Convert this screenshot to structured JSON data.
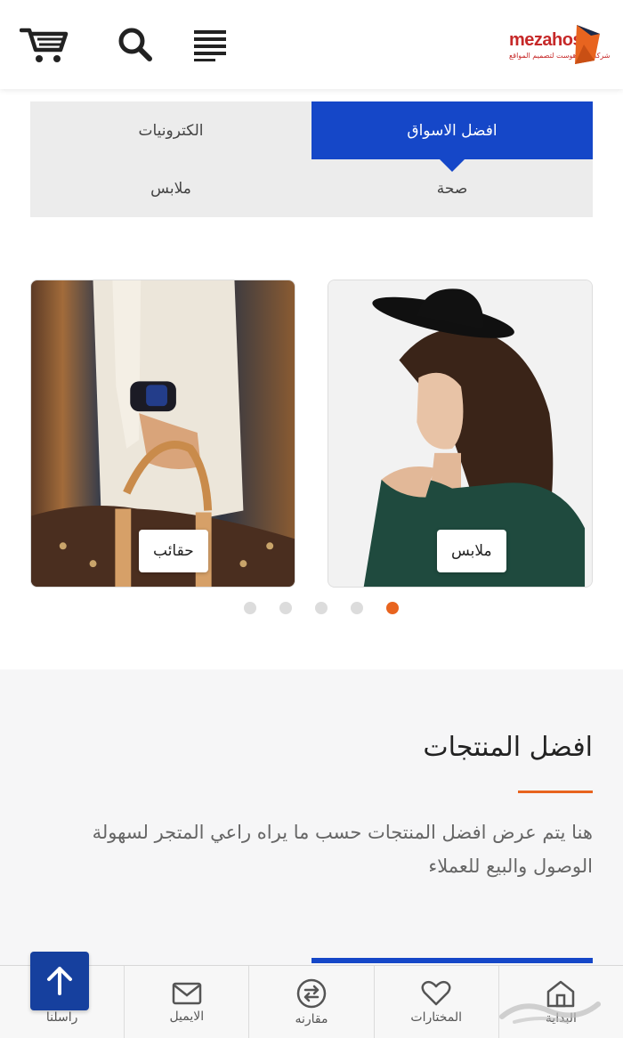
{
  "header": {
    "logo_text": "mezahost",
    "logo_subtitle": "شركة ميزا هوست لتصميم المواقع",
    "icons": [
      "cart-icon",
      "search-icon",
      "menu-icon"
    ]
  },
  "tabs": [
    {
      "label": "افضل الاسواق",
      "active": true
    },
    {
      "label": "الكترونيات",
      "active": false
    },
    {
      "label": "صحة",
      "active": false
    },
    {
      "label": "ملابس",
      "active": false
    }
  ],
  "carousel": {
    "cards": [
      {
        "label": "ملابس"
      },
      {
        "label": "حقائب"
      }
    ],
    "dot_count": 5,
    "active_dot": 5
  },
  "featured": {
    "title": "افضل المنتجات",
    "description": "هنا يتم عرض افضل المنتجات حسب ما يراه راعي المتجر لسهولة الوصول والبيع للعملاء"
  },
  "bottom_nav": [
    {
      "label": "راسلنا",
      "icon": "arrow-up-icon"
    },
    {
      "label": "الايميل",
      "icon": "mail-icon"
    },
    {
      "label": "مقارنه",
      "icon": "compare-icon"
    },
    {
      "label": "المختارات",
      "icon": "heart-icon"
    },
    {
      "label": "البداية",
      "icon": "home-icon"
    }
  ],
  "colors": {
    "primary": "#1547c8",
    "accent": "#e8641f",
    "top_button": "#16409e"
  }
}
